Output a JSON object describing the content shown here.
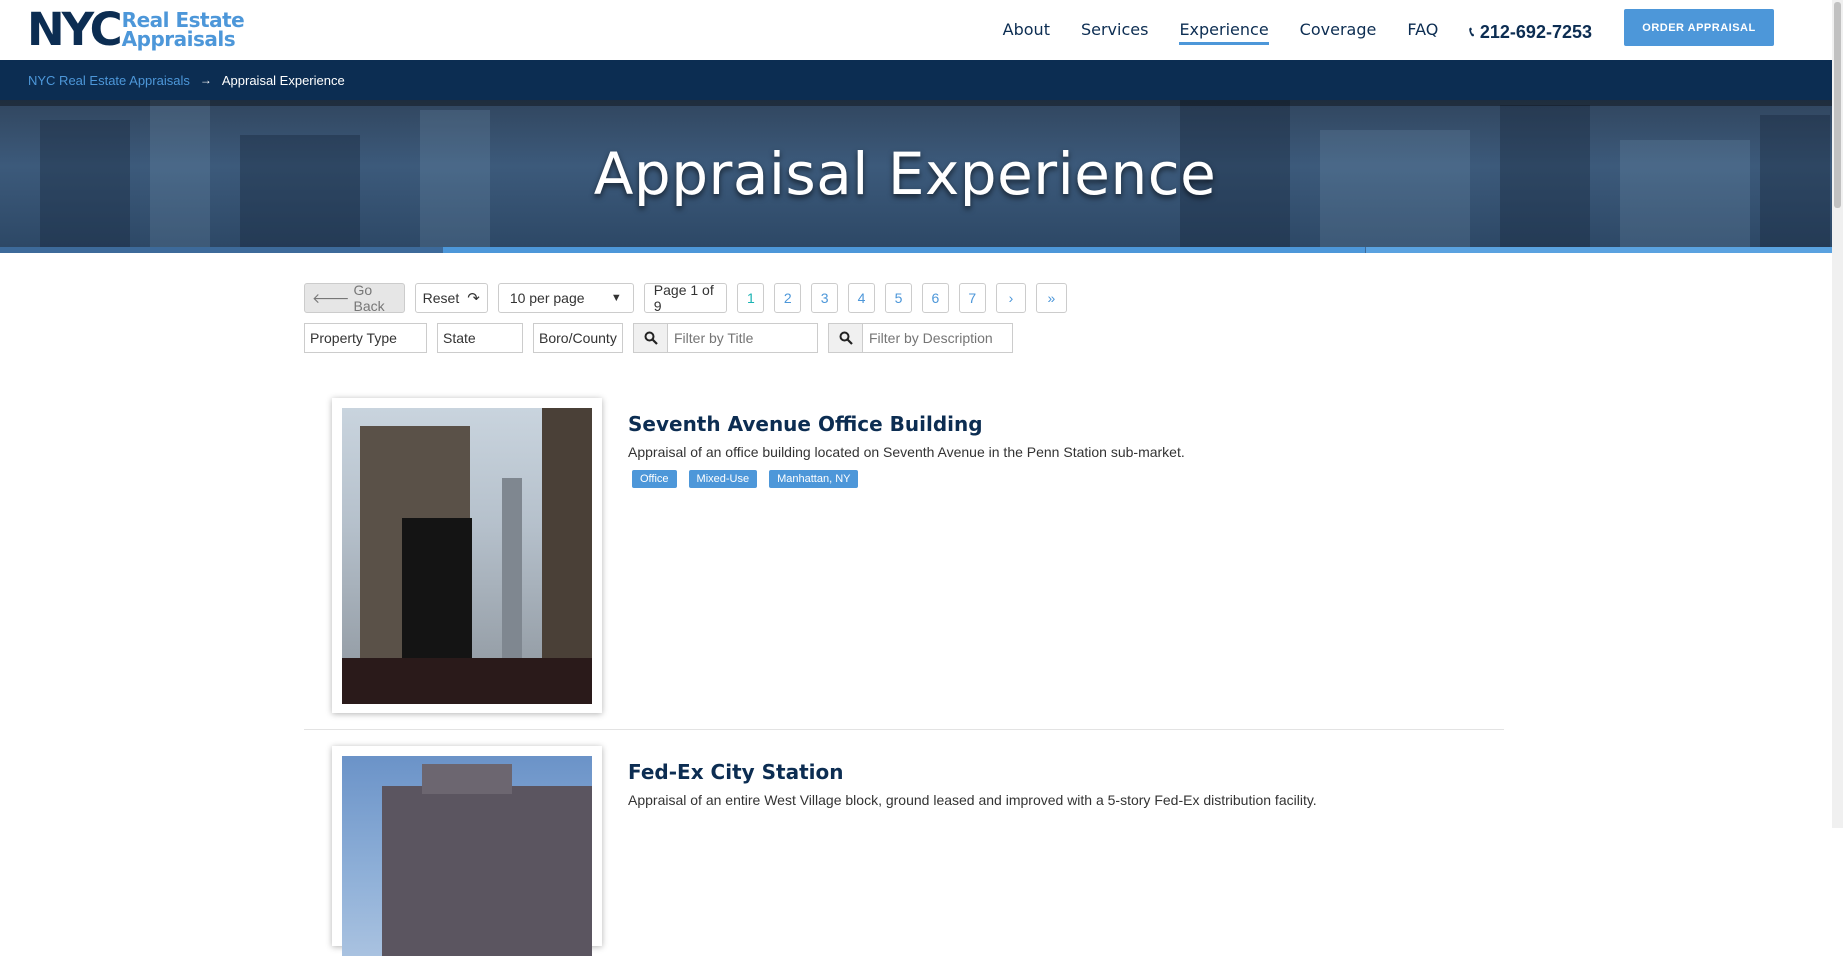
{
  "header": {
    "logo_main": "NYC",
    "logo_line1": "Real Estate",
    "logo_line2": "Appraisals",
    "nav": [
      {
        "label": "About",
        "active": false
      },
      {
        "label": "Services",
        "active": false
      },
      {
        "label": "Experience",
        "active": true
      },
      {
        "label": "Coverage",
        "active": false
      },
      {
        "label": "FAQ",
        "active": false
      }
    ],
    "phone_icon": "phone-icon",
    "phone": "212-692-7253",
    "order_button": "ORDER APPRAISAL"
  },
  "breadcrumb": {
    "home": "NYC Real Estate Appraisals",
    "separator": "→",
    "current": "Appraisal Experience"
  },
  "hero": {
    "title": "Appraisal Experience"
  },
  "controls": {
    "go_back": "Go Back",
    "reset": "Reset",
    "per_page": "10 per page",
    "page_info": "Page 1 of 9",
    "pages": [
      "1",
      "2",
      "3",
      "4",
      "5",
      "6",
      "7"
    ],
    "current_page": "1",
    "next": "›",
    "last": "»",
    "filters": {
      "property_type": "Property Type",
      "state": "State",
      "boro_county": "Boro/County",
      "title_placeholder": "Filter by Title",
      "description_placeholder": "Filter by Description"
    }
  },
  "listings": [
    {
      "title": "Seventh Avenue Office Building",
      "description": "Appraisal of an office building located on Seventh Avenue in the Penn Station sub-market.",
      "tags": [
        "Office",
        "Mixed-Use",
        "Manhattan, NY"
      ]
    },
    {
      "title": "Fed-Ex City Station",
      "description": "Appraisal of an entire West Village block, ground leased and improved with a 5-story Fed-Ex distribution facility.",
      "tags": []
    }
  ],
  "colors": {
    "navy": "#0c2d52",
    "accent": "#4d97d9",
    "current_page": "#1ab3b3"
  }
}
